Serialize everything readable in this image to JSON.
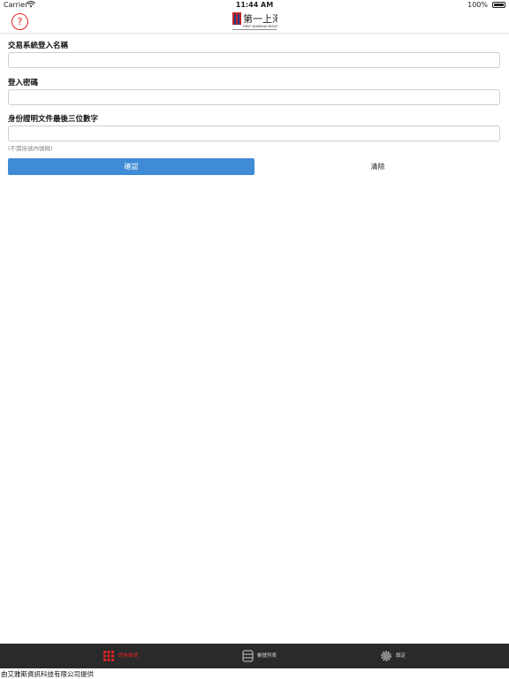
{
  "status_bar": {
    "carrier": "Carrier",
    "time": "11:44 AM",
    "battery": "100%"
  },
  "header": {
    "help_icon": "question-circle-icon",
    "logo_name": "第一上海",
    "logo_subtext": "FIRST SHANGHAI GROUP"
  },
  "form": {
    "username_label": "交易系統登入名稱",
    "username_value": "",
    "password_label": "登入密碼",
    "password_value": "",
    "id_label": "身份證明文件最後三位數字",
    "id_value": "",
    "id_hint": "(不需括號內號碼)",
    "confirm_label": "確認",
    "clear_label": "清除"
  },
  "tabs": [
    {
      "label": "證券帳號",
      "icon": "keypad-icon",
      "active": true
    },
    {
      "label": "帳號列表",
      "icon": "list-icon",
      "active": false
    },
    {
      "label": "設定",
      "icon": "gear-icon",
      "active": false
    }
  ],
  "footer": {
    "text": "由艾雅斯資訊科技有限公司提供"
  },
  "colors": {
    "accent": "#e02424",
    "button": "#3f8bd6",
    "tab_bar": "#2a2a2a"
  }
}
